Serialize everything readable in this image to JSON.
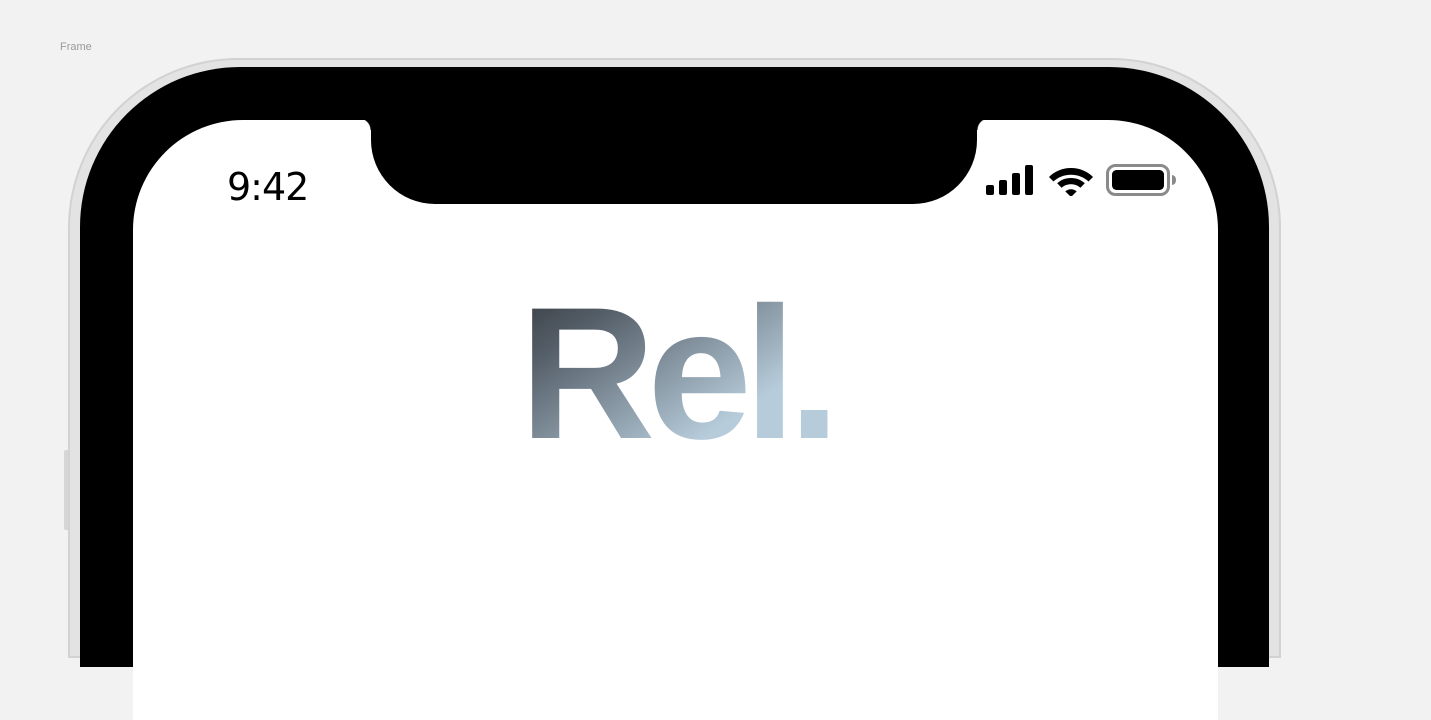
{
  "canvas": {
    "frame_label": "Frame"
  },
  "status_bar": {
    "time": "9:42",
    "icons": [
      "cellular-signal-icon",
      "wifi-icon",
      "battery-icon"
    ]
  },
  "app": {
    "logo_text": "Rel.",
    "logo_gradient": [
      "#2f3236",
      "#b7ccdb"
    ]
  },
  "colors": {
    "canvas_background": "#f2f2f2",
    "bezel": "#000000",
    "screen": "#ffffff"
  }
}
